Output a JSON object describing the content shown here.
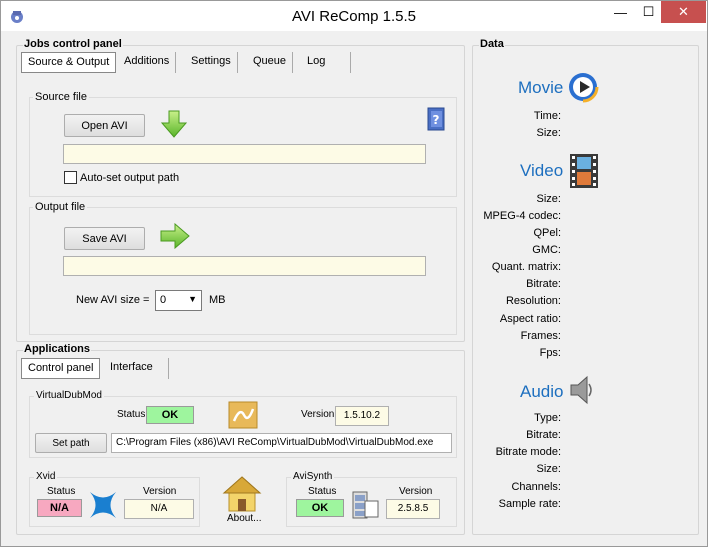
{
  "window": {
    "title": "AVI ReComp  1.5.5"
  },
  "controls": {
    "minimize": "—",
    "maximize": "☐",
    "close": "✕"
  },
  "jobs": {
    "title": "Jobs control panel",
    "tabs": [
      "Source & Output",
      "Additions",
      "Settings",
      "Queue",
      "Log"
    ],
    "source": {
      "title": "Source file",
      "open_label": "Open AVI",
      "path": "",
      "auto_label": "Auto-set output path"
    },
    "output": {
      "title": "Output file",
      "save_label": "Save AVI",
      "path": "",
      "size_label": "New AVI size =",
      "size_value": "0",
      "size_unit": "MB"
    }
  },
  "applications": {
    "title": "Applications",
    "tabs": [
      "Control panel",
      "Interface"
    ],
    "vdm": {
      "title": "VirtualDubMod",
      "status_label": "Status",
      "status_value": "OK",
      "version_label": "Version",
      "version_value": "1.5.10.2",
      "setpath_label": "Set path",
      "path": "C:\\Program Files (x86)\\AVI ReComp\\VirtualDubMod\\VirtualDubMod.exe"
    },
    "xvid": {
      "title": "Xvid",
      "status_label": "Status",
      "status_value": "N/A",
      "version_label": "Version",
      "version_value": "N/A"
    },
    "about_label": "About...",
    "avisynth": {
      "title": "AviSynth",
      "status_label": "Status",
      "status_value": "OK",
      "version_label": "Version",
      "version_value": "2.5.8.5"
    }
  },
  "data": {
    "title": "Data",
    "movie": {
      "title": "Movie",
      "fields": [
        "Time:",
        "Size:"
      ]
    },
    "video": {
      "title": "Video",
      "fields": [
        "Size:",
        "MPEG-4 codec:",
        "QPel:",
        "GMC:",
        "Quant. matrix:",
        "Bitrate:",
        "Resolution:",
        "Aspect ratio:",
        "Frames:",
        "Fps:"
      ]
    },
    "audio": {
      "title": "Audio",
      "fields": [
        "Type:",
        "Bitrate:",
        "Bitrate mode:",
        "Size:",
        "Channels:",
        "Sample rate:"
      ]
    }
  },
  "colors": {
    "accent": "#1d6fbf",
    "ok": "#9ef59e",
    "na": "#f7a8c0",
    "field": "#fdfbe6"
  }
}
